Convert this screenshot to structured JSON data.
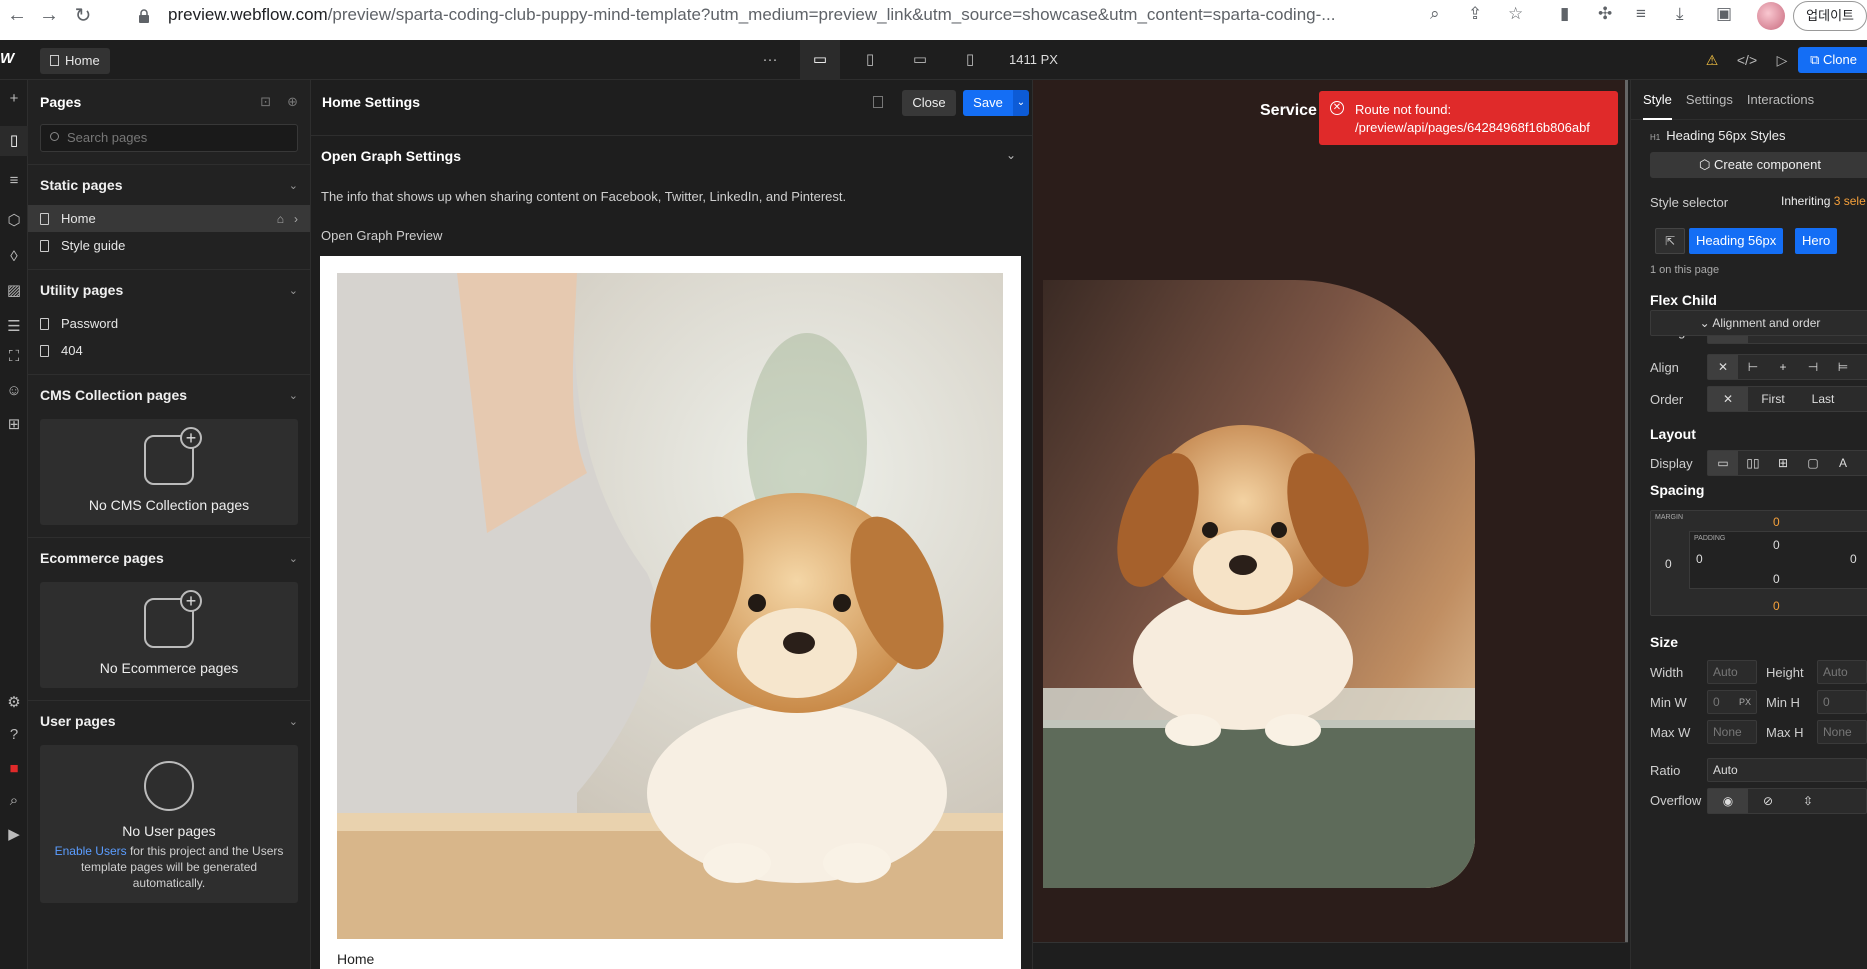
{
  "browser": {
    "url_host": "preview.webflow.com",
    "url_path": "/preview/sparta-coding-club-puppy-mind-template?utm_medium=preview_link&utm_source=showcase&utm_content=sparta-coding-...",
    "update_label": "업데이트"
  },
  "topbar": {
    "page_label": "Home",
    "width_readout": "1411 PX",
    "clone_label": "Clone"
  },
  "pages_panel": {
    "title": "Pages",
    "search_placeholder": "Search pages",
    "static": {
      "title": "Static pages",
      "items": [
        "Home",
        "Style guide"
      ]
    },
    "utility": {
      "title": "Utility pages",
      "items": [
        "Password",
        "404"
      ]
    },
    "cms": {
      "title": "CMS Collection pages",
      "empty": "No CMS Collection pages"
    },
    "ecommerce": {
      "title": "Ecommerce pages",
      "empty": "No Ecommerce pages"
    },
    "users": {
      "title": "User pages",
      "empty": "No User pages",
      "link": "Enable Users",
      "desc": " for this project and the Users template pages will be generated automatically."
    }
  },
  "settings": {
    "title": "Home Settings",
    "close_label": "Close",
    "save_label": "Save",
    "og_title": "Open Graph Settings",
    "og_desc": "The info that shows up when sharing content on Facebook, Twitter, LinkedIn, and Pinterest.",
    "og_preview_label": "Open Graph Preview",
    "og_caption": "Home"
  },
  "canvas": {
    "nav_text": "Service",
    "toast_title": "Route not found:",
    "toast_detail": "/preview/api/pages/64284968f16b806abf"
  },
  "style_panel": {
    "tabs": [
      "Style",
      "Settings",
      "Interactions"
    ],
    "element_label": "Heading 56px Styles",
    "element_tag": "H1",
    "create_component": "Create component",
    "style_selector": "Style selector",
    "inheriting": "Inheriting",
    "inheriting_count": "3 sele",
    "chips": [
      "Heading 56px",
      "Hero"
    ],
    "on_page": "1 on this page",
    "flex_child": "Flex Child",
    "sizing": "Sizing",
    "alignment_order": "Alignment and order",
    "align": "Align",
    "order": "Order",
    "order_first": "First",
    "order_last": "Last",
    "layout": "Layout",
    "display": "Display",
    "spacing": "Spacing",
    "margin_label": "MARGIN",
    "padding_label": "PADDING",
    "margin_top": "0",
    "margin_bottom": "0",
    "margin_left": "0",
    "padding_top": "0",
    "padding_bottom": "0",
    "padding_left": "0",
    "padding_right": "0",
    "size": "Size",
    "width": "Width",
    "height": "Height",
    "min_w": "Min W",
    "min_h": "Min H",
    "max_w": "Max W",
    "max_h": "Max H",
    "width_val": "Auto",
    "height_val": "Auto",
    "min_w_val": "0",
    "min_w_unit": "PX",
    "min_h_val": "0",
    "max_w_val": "None",
    "max_h_val": "None",
    "ratio": "Ratio",
    "ratio_val": "Auto",
    "overflow": "Overflow"
  }
}
